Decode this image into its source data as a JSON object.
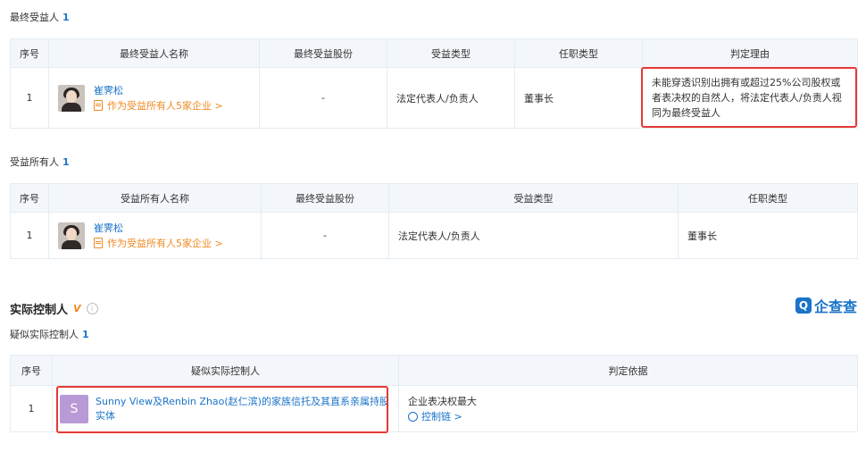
{
  "ubo": {
    "title": "最终受益人",
    "count": "1",
    "headers": [
      "序号",
      "最终受益人名称",
      "最终受益股份",
      "受益类型",
      "任职类型",
      "判定理由"
    ],
    "row": {
      "index": "1",
      "name": "崔霁松",
      "link": "作为受益所有人5家企业 >",
      "shares": "-",
      "benefit_type": "法定代表人/负责人",
      "position": "董事长",
      "reason": "未能穿透识别出拥有或超过25%公司股权或者表决权的自然人，将法定代表人/负责人视同为最终受益人"
    }
  },
  "bo": {
    "title": "受益所有人",
    "count": "1",
    "headers": [
      "序号",
      "受益所有人名称",
      "最终受益股份",
      "受益类型",
      "任职类型"
    ],
    "row": {
      "index": "1",
      "name": "崔霁松",
      "link": "作为受益所有人5家企业 >",
      "shares": "-",
      "benefit_type": "法定代表人/负责人",
      "position": "董事长"
    }
  },
  "controller": {
    "title": "实际控制人",
    "badge": "V",
    "info": "i",
    "logo_mark": "Q",
    "logo_text": "企查查",
    "sub_title": "疑似实际控制人",
    "sub_count": "1",
    "headers": [
      "序号",
      "疑似实际控制人",
      "判定依据"
    ],
    "row": {
      "index": "1",
      "avatar_letter": "S",
      "name": "Sunny View及Renbin Zhao(赵仁滨)的家族信托及其直系亲属持股实体",
      "basis": "企业表决权最大",
      "chain": "控制链 >"
    }
  },
  "colors": {
    "accent": "#1a73c9",
    "orange": "#f08a24",
    "highlight": "#e53935",
    "header_bg": "#f3f7fb"
  }
}
